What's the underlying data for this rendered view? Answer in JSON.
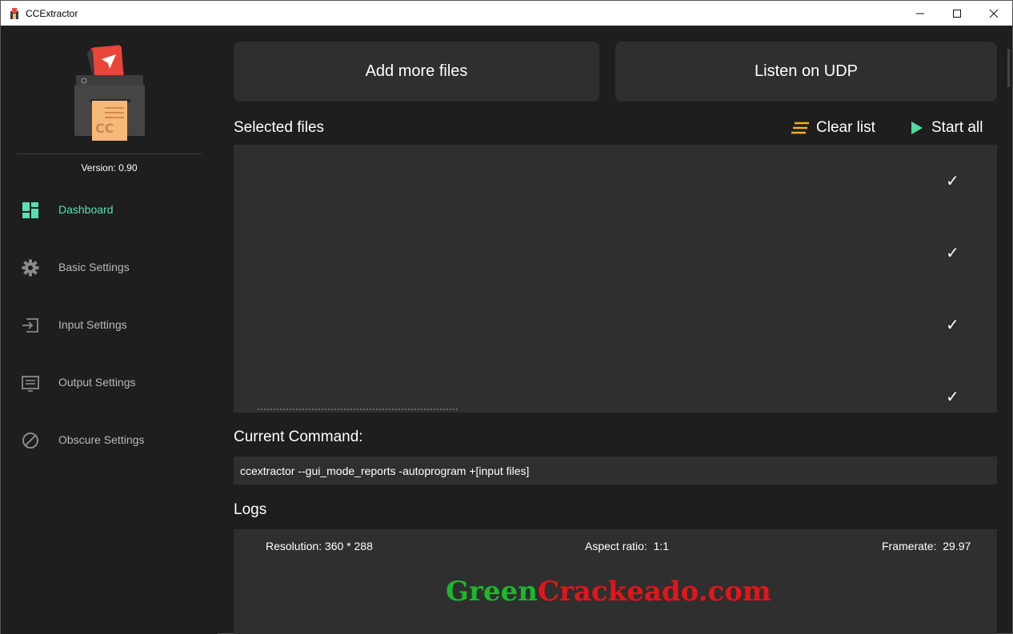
{
  "window": {
    "title": "CCExtractor",
    "minimize_glyph": "—",
    "maximize_glyph": "☐",
    "close_glyph": "✕"
  },
  "sidebar": {
    "version": "Version: 0.90",
    "logo_letters": "CC",
    "items": [
      {
        "label": "Dashboard",
        "icon": "dashboard-icon",
        "active": true
      },
      {
        "label": "Basic Settings",
        "icon": "gear-icon",
        "active": false
      },
      {
        "label": "Input Settings",
        "icon": "input-icon",
        "active": false
      },
      {
        "label": "Output Settings",
        "icon": "output-icon",
        "active": false
      },
      {
        "label": "Obscure Settings",
        "icon": "block-icon",
        "active": false
      }
    ]
  },
  "main": {
    "add_files_label": "Add more files",
    "listen_udp_label": "Listen on UDP",
    "selected_files_title": "Selected files",
    "clear_list_label": "Clear list",
    "start_all_label": "Start all",
    "file_rows": [
      {
        "checked": true
      },
      {
        "checked": true
      },
      {
        "checked": true
      },
      {
        "checked": true
      }
    ],
    "check_glyph": "✓",
    "current_command_title": "Current Command:",
    "current_command": "ccextractor --gui_mode_reports -autoprogram +[input files]",
    "logs_title": "Logs",
    "logs": {
      "resolution": "Resolution: 360 * 288",
      "aspect_ratio": "Aspect ratio:  1:1",
      "framerate": "Framerate:  29.97"
    },
    "watermark_green": "Green",
    "watermark_red": "Crackeado",
    "watermark_tail": ".com"
  },
  "colors": {
    "background": "#1e1e1e",
    "panel": "#2f2f2f",
    "accent_teal": "#58e0b0",
    "clear_list_yellow": "#f0b020",
    "start_green": "#4ddba0"
  }
}
